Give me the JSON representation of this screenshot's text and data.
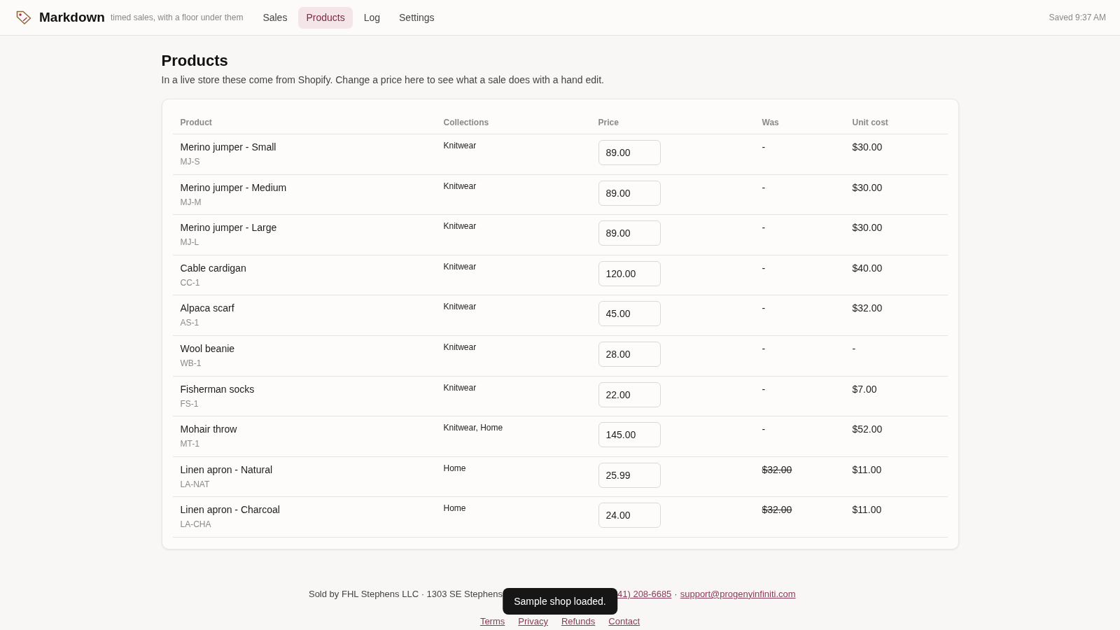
{
  "header": {
    "brand": "Markdown",
    "tagline": "timed sales, with a floor under them",
    "nav": [
      {
        "label": "Sales",
        "selected": false
      },
      {
        "label": "Products",
        "selected": true
      },
      {
        "label": "Log",
        "selected": false
      },
      {
        "label": "Settings",
        "selected": false
      }
    ],
    "save_status": "Saved 9:37 AM"
  },
  "page": {
    "title": "Products",
    "description": "In a live store these come from Shopify. Change a price here to see what a sale does with a hand edit."
  },
  "table": {
    "columns": [
      "Product",
      "Collections",
      "Price",
      "Was",
      "Unit cost"
    ],
    "rows": [
      {
        "name": "Merino jumper - Small",
        "sku": "MJ-S",
        "collections": "Knitwear",
        "price": "89.00",
        "was": "-",
        "was_struck": false,
        "unit_cost": "$30.00"
      },
      {
        "name": "Merino jumper - Medium",
        "sku": "MJ-M",
        "collections": "Knitwear",
        "price": "89.00",
        "was": "-",
        "was_struck": false,
        "unit_cost": "$30.00"
      },
      {
        "name": "Merino jumper - Large",
        "sku": "MJ-L",
        "collections": "Knitwear",
        "price": "89.00",
        "was": "-",
        "was_struck": false,
        "unit_cost": "$30.00"
      },
      {
        "name": "Cable cardigan",
        "sku": "CC-1",
        "collections": "Knitwear",
        "price": "120.00",
        "was": "-",
        "was_struck": false,
        "unit_cost": "$40.00"
      },
      {
        "name": "Alpaca scarf",
        "sku": "AS-1",
        "collections": "Knitwear",
        "price": "45.00",
        "was": "-",
        "was_struck": false,
        "unit_cost": "$32.00"
      },
      {
        "name": "Wool beanie",
        "sku": "WB-1",
        "collections": "Knitwear",
        "price": "28.00",
        "was": "-",
        "was_struck": false,
        "unit_cost": "-"
      },
      {
        "name": "Fisherman socks",
        "sku": "FS-1",
        "collections": "Knitwear",
        "price": "22.00",
        "was": "-",
        "was_struck": false,
        "unit_cost": "$7.00"
      },
      {
        "name": "Mohair throw",
        "sku": "MT-1",
        "collections": "Knitwear, Home",
        "price": "145.00",
        "was": "-",
        "was_struck": false,
        "unit_cost": "$52.00"
      },
      {
        "name": "Linen apron - Natural",
        "sku": "LA-NAT",
        "collections": "Home",
        "price": "25.99",
        "was": "$32.00",
        "was_struck": true,
        "unit_cost": "$11.00"
      },
      {
        "name": "Linen apron - Charcoal",
        "sku": "LA-CHA",
        "collections": "Home",
        "price": "24.00",
        "was": "$32.00",
        "was_struck": true,
        "unit_cost": "$11.00"
      }
    ]
  },
  "footer": {
    "address_text": "Sold by FHL Stephens LLC · 1303 SE Stephens",
    "phone": "41) 208-6685",
    "separator": "·",
    "email": "support@progenyinfiniti.com",
    "links": [
      "Terms",
      "Privacy",
      "Refunds",
      "Contact"
    ]
  },
  "toast": {
    "message": "Sample shop loaded."
  }
}
